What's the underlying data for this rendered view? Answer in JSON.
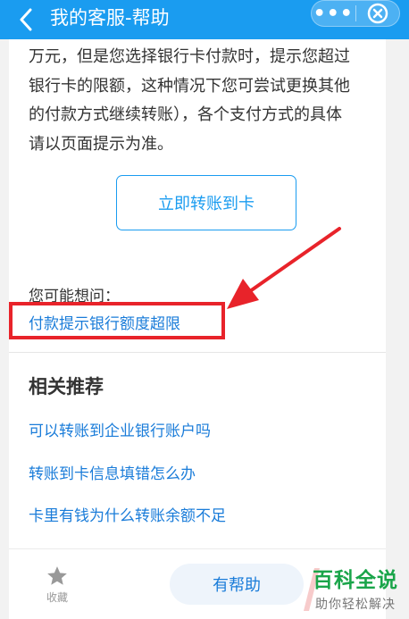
{
  "nav": {
    "title": "我的客服-帮助",
    "more_label": "•••",
    "back_icon": "chevron-left-icon",
    "close_icon": "close-circle-icon"
  },
  "article": {
    "lines": [
      "万元，但是您选择银行卡付款时，提示您超过",
      "银行卡的限额，这种情况下您可尝试更换其他",
      "的付款方式继续转账），各个支付方式的具体",
      "请以页面提示为准。"
    ]
  },
  "action": {
    "transfer_label": "立即转账到卡"
  },
  "ask": {
    "label": "您可能想问：",
    "link": "付款提示银行额度超限"
  },
  "recommend": {
    "title": "相关推荐",
    "items": [
      "可以转账到企业银行账户吗",
      "转账到卡信息填错怎么办",
      "卡里有钱为什么转账余额不足"
    ]
  },
  "bottom": {
    "fav_label": "收藏",
    "helpful_label": "有帮助"
  },
  "watermark": {
    "main": "百科全说",
    "sub": "助你轻松解决"
  },
  "colors": {
    "accent": "#1a9cf0",
    "link": "#1a7cd9",
    "highlight": "#e8232a",
    "watermark": "#1aa54a"
  }
}
